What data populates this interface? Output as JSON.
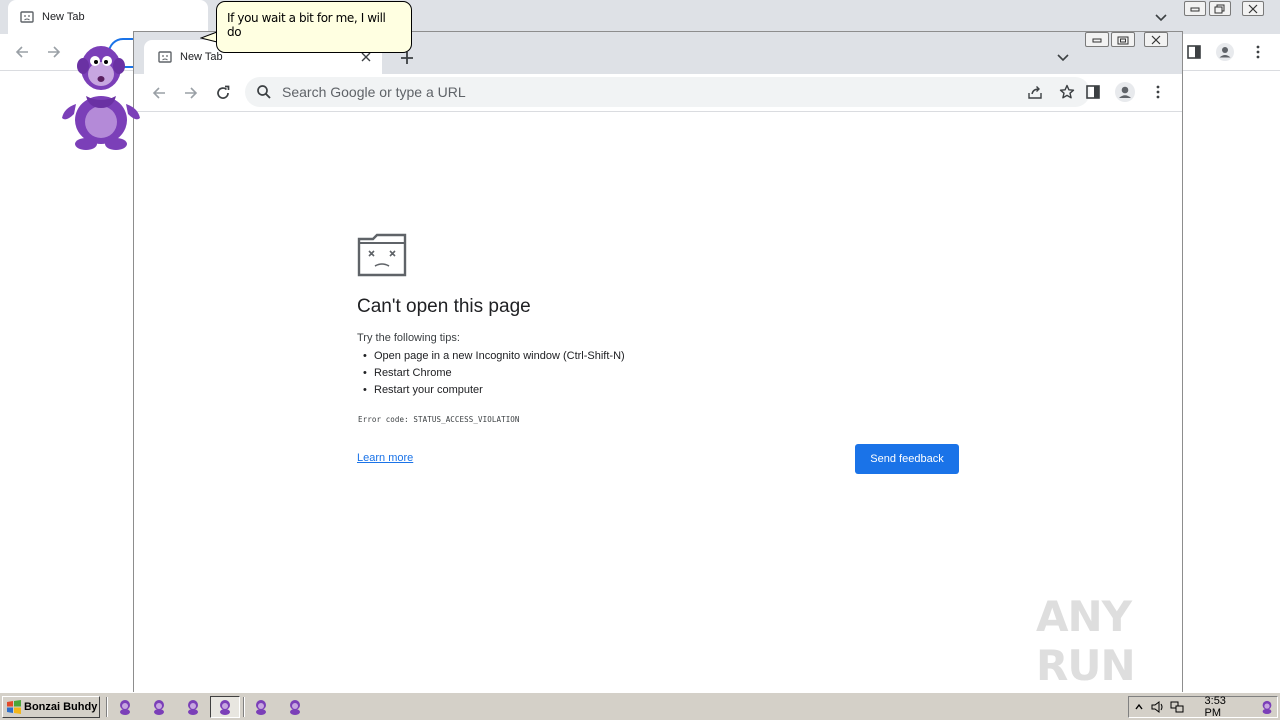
{
  "bg_window": {
    "tab_title": "New Tab"
  },
  "fg_window": {
    "tab_title": "New Tab",
    "omnibox_placeholder": "Search Google or type a URL"
  },
  "error_page": {
    "title": "Can't open this page",
    "tips_label": "Try the following tips:",
    "tips": [
      "Open page in a new Incognito window (Ctrl-Shift-N)",
      "Restart Chrome",
      "Restart your computer"
    ],
    "error_code": "Error code: STATUS_ACCESS_VIOLATION",
    "learn_more": "Learn more",
    "send_feedback": "Send feedback"
  },
  "bonzi": {
    "balloon_text": "If you wait a bit for me, I will do"
  },
  "watermark": {
    "text": "ANY RUN"
  },
  "taskbar": {
    "start_label": "Bonzai Buhdy",
    "clock": "3:53 PM"
  },
  "colors": {
    "accent": "#1a73e8",
    "tabstrip": "#dee1e6",
    "taskbar": "#d4d0c8",
    "balloon": "#ffffe1",
    "bonzi_purple": "#7b3fb8"
  }
}
